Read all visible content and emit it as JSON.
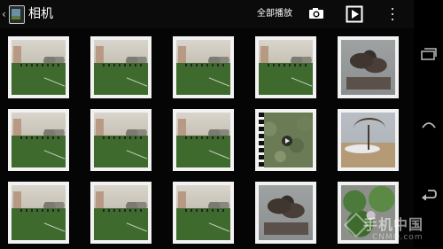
{
  "action_bar": {
    "title": "相机",
    "play_all_label": "全部播放"
  },
  "icons": {
    "camera": "camera-icon",
    "slideshow": "slideshow-icon",
    "overflow": "overflow-menu-icon",
    "back": "back-icon",
    "home": "home-icon",
    "recents": "recent-apps-icon"
  },
  "grid": {
    "rows": 3,
    "columns": 5,
    "items": [
      {
        "kind": "photo",
        "subject": "field"
      },
      {
        "kind": "photo",
        "subject": "field"
      },
      {
        "kind": "photo",
        "subject": "field"
      },
      {
        "kind": "photo",
        "subject": "field"
      },
      {
        "kind": "photo",
        "subject": "sculpture"
      },
      {
        "kind": "photo",
        "subject": "field"
      },
      {
        "kind": "photo",
        "subject": "field"
      },
      {
        "kind": "photo",
        "subject": "field"
      },
      {
        "kind": "video",
        "subject": "grass"
      },
      {
        "kind": "photo",
        "subject": "tree"
      },
      {
        "kind": "photo",
        "subject": "field"
      },
      {
        "kind": "photo",
        "subject": "field"
      },
      {
        "kind": "photo",
        "subject": "field"
      },
      {
        "kind": "photo",
        "subject": "sculpture"
      },
      {
        "kind": "photo",
        "subject": "flowers"
      }
    ]
  },
  "watermark": {
    "main": "手机中国",
    "sub": "CNMO.com"
  },
  "colors": {
    "background": "#050505",
    "action_bar": "#0b0b0b",
    "frame": "#f2f2f2",
    "nav_bar": "#000000"
  }
}
